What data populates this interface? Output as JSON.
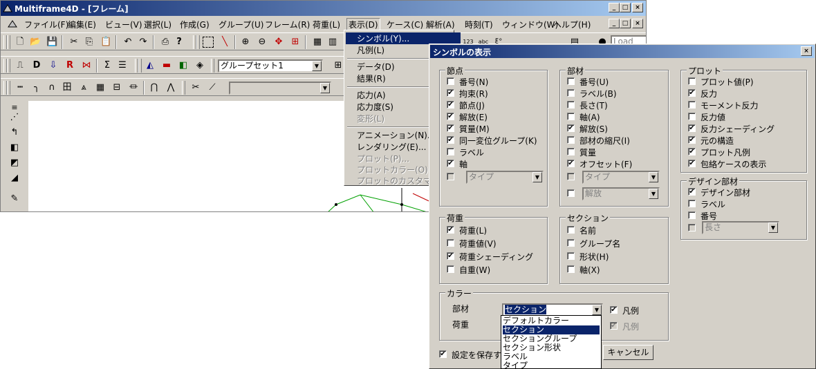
{
  "main_window": {
    "title": "Multiframe4D - [フレーム]",
    "controls": [
      "_",
      "□",
      "×"
    ],
    "mdi_controls": [
      "_",
      "□",
      "×"
    ],
    "menus": [
      "ファイル(F)",
      "編集(E)",
      "ビュー(V)",
      "選択(L)",
      "作成(G)",
      "グループ(U)",
      "フレーム(R)",
      "荷重(L)",
      "表示(D)",
      "ケース(C)",
      "解析(A)",
      "時刻(T)",
      "ウィンドウ(W)",
      "ヘルプ(H)"
    ],
    "group_combo": "グループセット1",
    "load_case_combo": "Load Cas",
    "toolbar_labels": [
      "123",
      "abc",
      "ξ°"
    ]
  },
  "view_menu": {
    "items": [
      {
        "label": "シンボル(Y)...",
        "state": "highlighted"
      },
      {
        "label": "凡例(L)",
        "state": "normal"
      },
      {
        "label": "データ(D)",
        "state": "normal"
      },
      {
        "label": "結果(R)",
        "state": "normal"
      },
      {
        "label": "応力(A)",
        "state": "normal"
      },
      {
        "label": "応力度(S)",
        "state": "normal"
      },
      {
        "label": "変形(L)",
        "state": "disabled"
      },
      {
        "label": "アニメーション(N)...",
        "state": "normal"
      },
      {
        "label": "レンダリング(E)...",
        "state": "normal"
      },
      {
        "label": "プロット(P)...",
        "state": "disabled"
      },
      {
        "label": "プロットカラー(O)...",
        "state": "disabled"
      },
      {
        "label": "プロットのカスタマイズ(U)",
        "state": "disabled"
      }
    ]
  },
  "dialog": {
    "title": "シンボルの表示",
    "close": "×",
    "nodes": {
      "label": "節点",
      "items": [
        {
          "label": "番号(N)",
          "checked": false
        },
        {
          "label": "拘束(R)",
          "checked": true
        },
        {
          "label": "節点(J)",
          "checked": true
        },
        {
          "label": "解放(E)",
          "checked": true
        },
        {
          "label": "質量(M)",
          "checked": true
        },
        {
          "label": "同一変位グループ(K)",
          "checked": true
        },
        {
          "label": "ラベル",
          "checked": false
        },
        {
          "label": "軸",
          "checked": true
        }
      ],
      "combo": "タイプ"
    },
    "members": {
      "label": "部材",
      "items": [
        {
          "label": "番号(U)",
          "checked": false
        },
        {
          "label": "ラベル(B)",
          "checked": false
        },
        {
          "label": "長さ(T)",
          "checked": false
        },
        {
          "label": "軸(A)",
          "checked": false
        },
        {
          "label": "解放(S)",
          "checked": true
        },
        {
          "label": "部材の縮尺(I)",
          "checked": false
        },
        {
          "label": "質量",
          "checked": false
        },
        {
          "label": "オフセット(F)",
          "checked": true
        }
      ],
      "combo1": "タイプ",
      "combo2": "解放"
    },
    "plot": {
      "label": "プロット",
      "items": [
        {
          "label": "プロット値(P)",
          "checked": false
        },
        {
          "label": "反力",
          "checked": true
        },
        {
          "label": "モーメント反力",
          "checked": false
        },
        {
          "label": "反力値",
          "checked": false
        },
        {
          "label": "反力シェーディング",
          "checked": true
        },
        {
          "label": "元の構造",
          "checked": true
        },
        {
          "label": "プロット凡例",
          "checked": true
        },
        {
          "label": "包絡ケースの表示",
          "checked": true
        }
      ]
    },
    "design": {
      "label": "デザイン部材",
      "items": [
        {
          "label": "デザイン部材",
          "checked": true
        },
        {
          "label": "ラベル",
          "checked": false
        },
        {
          "label": "番号",
          "checked": false
        }
      ],
      "combo": "長さ"
    },
    "loads": {
      "label": "荷重",
      "items": [
        {
          "label": "荷重(L)",
          "checked": true
        },
        {
          "label": "荷重値(V)",
          "checked": false
        },
        {
          "label": "荷重シェーディング",
          "checked": true
        },
        {
          "label": "自重(W)",
          "checked": false
        }
      ]
    },
    "section": {
      "label": "セクション",
      "items": [
        {
          "label": "名前",
          "checked": false
        },
        {
          "label": "グループ名",
          "checked": false
        },
        {
          "label": "形状(H)",
          "checked": false
        },
        {
          "label": "軸(X)",
          "checked": false
        }
      ]
    },
    "color": {
      "label": "カラー",
      "member_label": "部材",
      "member_value": "セクション",
      "member_legend": {
        "label": "凡例",
        "checked": true
      },
      "load_label": "荷重",
      "load_legend": {
        "label": "凡例",
        "checked": true
      },
      "list_options": [
        "デフォルトカラー",
        "セクション",
        "セクショングループ",
        "セクション形状",
        "ラベル",
        "タイプ"
      ]
    },
    "save_settings": {
      "label": "設定を保存す",
      "checked": true
    },
    "cancel_button": "キャンセル"
  }
}
